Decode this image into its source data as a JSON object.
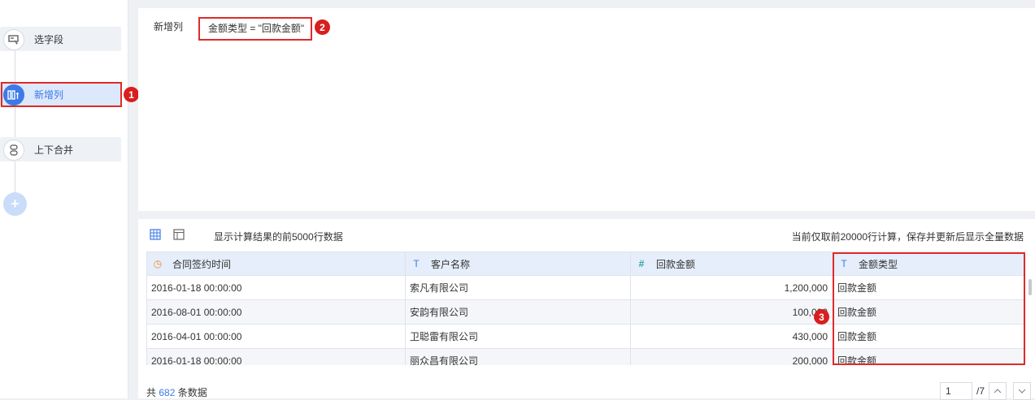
{
  "steps": [
    {
      "label": "选字段",
      "icon": "select-field-icon"
    },
    {
      "label": "新增列",
      "icon": "add-column-icon"
    },
    {
      "label": "上下合并",
      "icon": "merge-icon"
    }
  ],
  "add_step_symbol": "+",
  "formula": {
    "title": "新增列",
    "expression": "金额类型 = \"回款金额\""
  },
  "annotations": [
    "1",
    "2",
    "3"
  ],
  "preview": {
    "note": "显示计算结果的前5000行数据",
    "right_note": "当前仅取前20000行计算，保存并更新后显示全量数据",
    "columns": [
      {
        "label": "合同签约时间",
        "type": "time"
      },
      {
        "label": "客户名称",
        "type": "text"
      },
      {
        "label": "回款金额",
        "type": "number"
      },
      {
        "label": "金额类型",
        "type": "text"
      }
    ],
    "rows": [
      [
        "2016-01-18 00:00:00",
        "索凡有限公司",
        "1,200,000",
        "回款金额"
      ],
      [
        "2016-08-01 00:00:00",
        "安韵有限公司",
        "100,000",
        "回款金额"
      ],
      [
        "2016-04-01 00:00:00",
        "卫聪雷有限公司",
        "430,000",
        "回款金额"
      ],
      [
        "2016-01-18 00:00:00",
        "丽众昌有限公司",
        "200,000",
        "回款金额"
      ]
    ],
    "footer": {
      "prefix": "共",
      "count": "682",
      "suffix": "条数据",
      "page": "1",
      "total_pages": "/7"
    }
  },
  "colors": {
    "accent": "#3d7ae6",
    "annotation": "#e02a2a"
  }
}
